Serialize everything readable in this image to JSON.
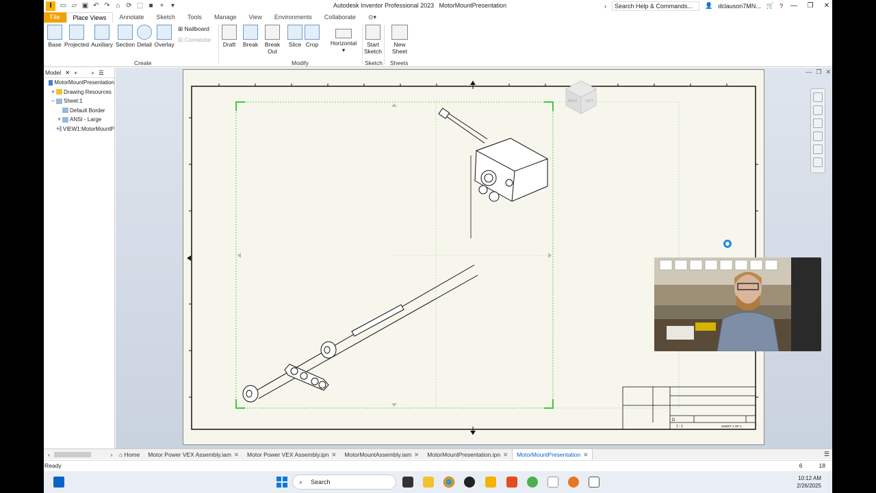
{
  "app": {
    "title": "Autodesk Inventor Professional 2023",
    "document": "MotorMountPresentation",
    "logo_letter": "I",
    "help_search": "Search Help & Commands...",
    "user": "dclauson7MN..."
  },
  "tabs": [
    "File",
    "Place Views",
    "Annotate",
    "Sketch",
    "Tools",
    "Manage",
    "View",
    "Environments",
    "Collaborate"
  ],
  "active_tab": "Place Views",
  "ribbon": {
    "create": {
      "label": "Create",
      "buttons": [
        "Base",
        "Projected",
        "Auxiliary",
        "Section",
        "Detail",
        "Overlay"
      ],
      "small": [
        "Nailboard",
        "Connector"
      ]
    },
    "modify": {
      "label": "Modify",
      "buttons": [
        "Draft",
        "Break",
        "Break Out",
        "Slice",
        "Crop",
        "Horizontal"
      ]
    },
    "sketch": {
      "label": "Sketch",
      "start_line1": "Start",
      "start_line2": "Sketch"
    },
    "sheets": {
      "label": "Sheets",
      "new_sheet": "New Sheet"
    }
  },
  "browser": {
    "title": "Model",
    "tree": [
      {
        "label": "MotorMountPresentation",
        "indent": 0,
        "expander": ""
      },
      {
        "label": "Drawing Resources",
        "indent": 1,
        "expander": "+"
      },
      {
        "label": "Sheet:1",
        "indent": 1,
        "expander": "−"
      },
      {
        "label": "Default Border",
        "indent": 2,
        "expander": ""
      },
      {
        "label": "ANSI - Large",
        "indent": 2,
        "expander": "+"
      },
      {
        "label": "VIEW1:MotorMountP",
        "indent": 2,
        "expander": "+"
      }
    ]
  },
  "viewcube": {
    "back": "BACK",
    "left": "LEFT"
  },
  "title_block": {
    "size": "D",
    "scale": "1 : 1",
    "sheet": "SHEET 1 OF 1"
  },
  "doc_tabs": [
    {
      "label": "Home",
      "closable": false,
      "active": false
    },
    {
      "label": "Motor Power VEX Assembly.iam",
      "closable": true,
      "active": false
    },
    {
      "label": "Motor Power VEX Assembly.ipn",
      "closable": true,
      "active": false
    },
    {
      "label": "MotorMountAssembly.iam",
      "closable": true,
      "active": false
    },
    {
      "label": "MotorMountPresentation.ipn",
      "closable": true,
      "active": false
    },
    {
      "label": "MotorMountPresentation",
      "closable": true,
      "active": true
    }
  ],
  "status": {
    "text": "Ready",
    "num1": "6",
    "num2": "18"
  },
  "taskbar": {
    "search": "Search",
    "time": "10:12 AM",
    "date": "2/26/2025"
  },
  "colors": {
    "accent_file": "#f0a20a",
    "sheet": "#f7f6ec",
    "selection": "#3cc83c",
    "active_tab": "#0a64c8"
  }
}
